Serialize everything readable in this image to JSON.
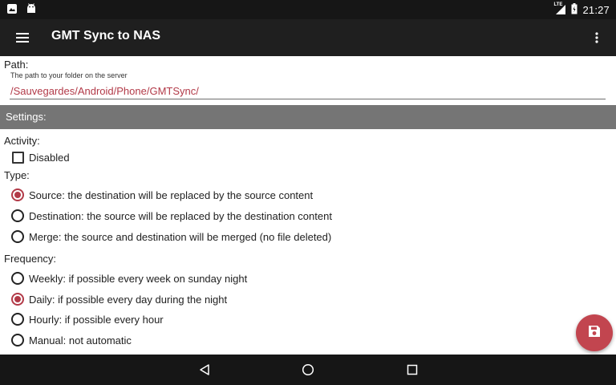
{
  "status_bar": {
    "notification_icons": [
      "image-icon",
      "android-icon"
    ],
    "network_label": "LTE",
    "time": "21:27"
  },
  "app_bar": {
    "title": "GMT Sync to NAS",
    "menu_icon": "hamburger-menu-icon",
    "overflow_icon": "more-vertical-icon"
  },
  "path": {
    "label": "Path:",
    "hint": "The path to your folder on the server",
    "value": "/Sauvegardes/Android/Phone/GMTSync/"
  },
  "settings": {
    "header": "Settings:",
    "activity": {
      "label": "Activity:",
      "checkbox_label": "Disabled",
      "checked": false
    },
    "type": {
      "label": "Type:",
      "options": [
        {
          "label": "Source: the destination will be replaced by the source content",
          "selected": true
        },
        {
          "label": "Destination: the source will be replaced by the destination content",
          "selected": false
        },
        {
          "label": "Merge: the source and destination will be merged (no file deleted)",
          "selected": false
        }
      ]
    },
    "frequency": {
      "label": "Frequency:",
      "options": [
        {
          "label": "Weekly: if possible every week on sunday night",
          "selected": false
        },
        {
          "label": "Daily: if possible every day during the night",
          "selected": true
        },
        {
          "label": "Hourly: if possible every hour",
          "selected": false
        },
        {
          "label": "Manual: not automatic",
          "selected": false
        }
      ]
    }
  },
  "fab": {
    "icon": "save-icon"
  },
  "nav_bar": {
    "icons": [
      "back-icon",
      "home-icon",
      "recents-icon"
    ]
  },
  "colors": {
    "accent": "#b23a48",
    "fab": "#c2454f",
    "app_bar": "#1f1f1f",
    "status_bar": "#161616",
    "settings_header": "#757575"
  }
}
